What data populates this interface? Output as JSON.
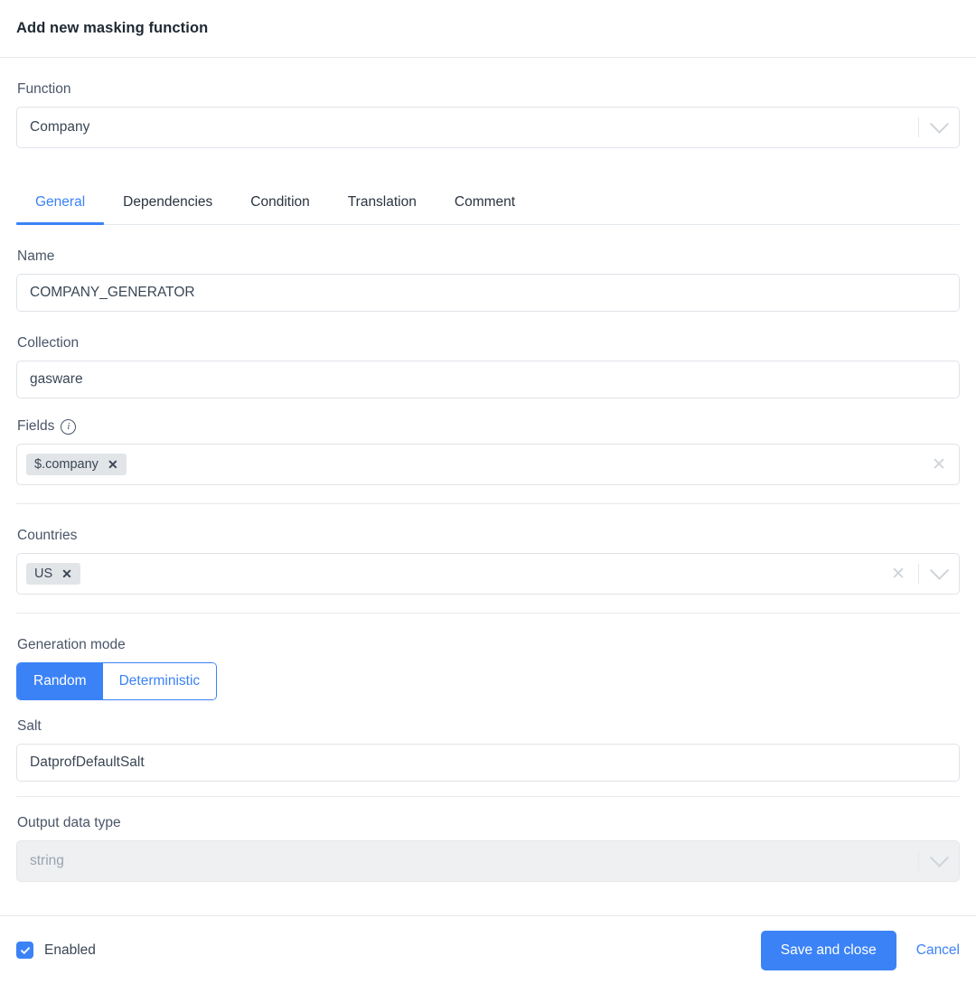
{
  "header": {
    "title": "Add new masking function"
  },
  "form": {
    "function": {
      "label": "Function",
      "value": "Company",
      "dropdown_icon": "chevron-down-icon"
    },
    "tabs": [
      {
        "label": "General",
        "active": true
      },
      {
        "label": "Dependencies",
        "active": false
      },
      {
        "label": "Condition",
        "active": false
      },
      {
        "label": "Translation",
        "active": false
      },
      {
        "label": "Comment",
        "active": false
      }
    ],
    "name": {
      "label": "Name",
      "value": "COMPANY_GENERATOR"
    },
    "collection": {
      "label": "Collection",
      "value": "gasware"
    },
    "fields": {
      "label": "Fields",
      "info_icon": "info-circle-icon",
      "chips": [
        "$.company"
      ],
      "clear_icon": "clear-icon"
    },
    "countries": {
      "label": "Countries",
      "chips": [
        "US"
      ],
      "clear_icon": "clear-icon",
      "dropdown_icon": "chevron-down-icon"
    },
    "generation_mode": {
      "label": "Generation mode",
      "options": [
        {
          "label": "Random",
          "active": true
        },
        {
          "label": "Deterministic",
          "active": false
        }
      ]
    },
    "salt": {
      "label": "Salt",
      "value": "DatprofDefaultSalt"
    },
    "output_data_type": {
      "label": "Output data type",
      "value": "string",
      "disabled": true,
      "dropdown_icon": "chevron-down-icon"
    }
  },
  "footer": {
    "enabled_label": "Enabled",
    "enabled_checked": true,
    "save_label": "Save and close",
    "cancel_label": "Cancel"
  },
  "colors": {
    "accent": "#3b82f6",
    "border": "#dfe3e8",
    "chip_bg": "#e2e5e8",
    "text": "#3a4654",
    "disabled_bg": "#eef0f2"
  }
}
